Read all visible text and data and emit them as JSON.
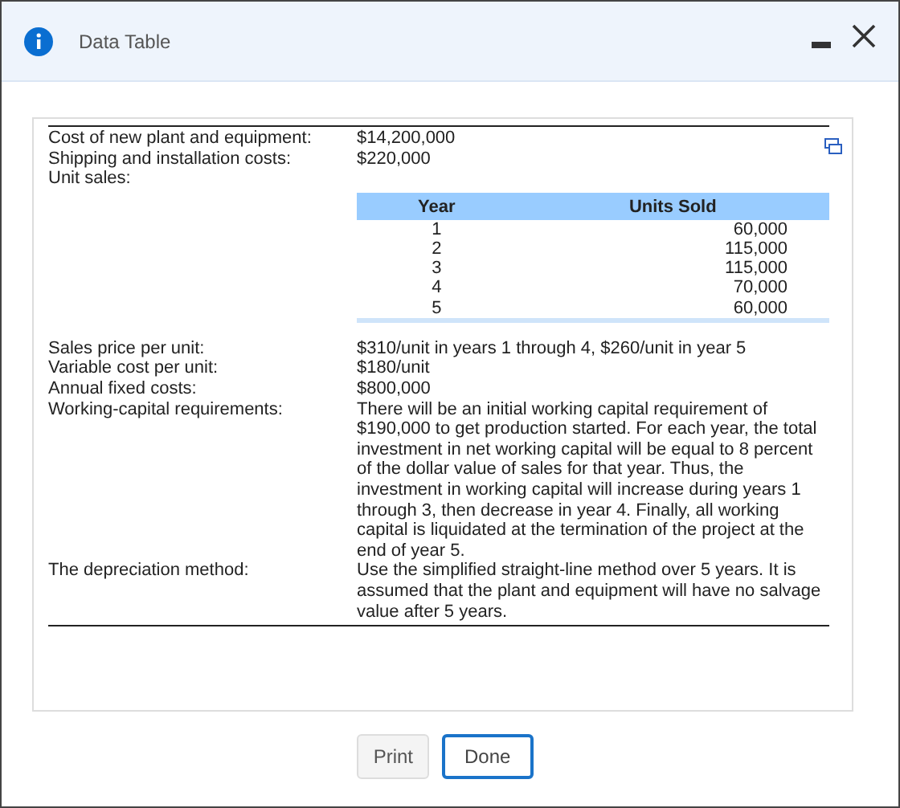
{
  "window": {
    "title": "Data Table"
  },
  "rows": [
    {
      "kind": "text",
      "label": "Cost of new plant and equipment:",
      "value": "$14,200,000"
    },
    {
      "kind": "text",
      "label": "Shipping and installation costs:",
      "value": "$220,000"
    },
    {
      "kind": "table",
      "label": "Unit sales:",
      "columns": [
        "Year",
        "Units Sold"
      ],
      "rows": [
        [
          "1",
          "60,000"
        ],
        [
          "2",
          "115,000"
        ],
        [
          "3",
          "115,000"
        ],
        [
          "4",
          "70,000"
        ],
        [
          "5",
          "60,000"
        ]
      ]
    },
    {
      "kind": "text",
      "label": "Sales price per unit:",
      "value": "$310/unit in years 1 through 4, $260/unit in year 5"
    },
    {
      "kind": "text",
      "label": "Variable cost per unit:",
      "value": "$180/unit"
    },
    {
      "kind": "text",
      "label": "Annual fixed costs:",
      "value": "$800,000"
    },
    {
      "kind": "text",
      "label": "Working-capital requirements:",
      "value": "There will be an initial working capital requirement of $190,000 to get production started.  For each year, the total investment in net working capital will be equal to 8 percent of the dollar value of sales for that year.  Thus, the investment in working capital will increase during years 1 through 3, then decrease in year 4.  Finally, all working capital is liquidated at the termination of the project at the end of year 5."
    },
    {
      "kind": "text",
      "label": "The depreciation method:",
      "value": "Use the simplified straight-line method over 5 years.  It is assumed that the plant and equipment will have no salvage value after 5 years."
    }
  ],
  "buttons": [
    {
      "label": "Print",
      "selected": false
    },
    {
      "label": "Done",
      "selected": true
    }
  ]
}
